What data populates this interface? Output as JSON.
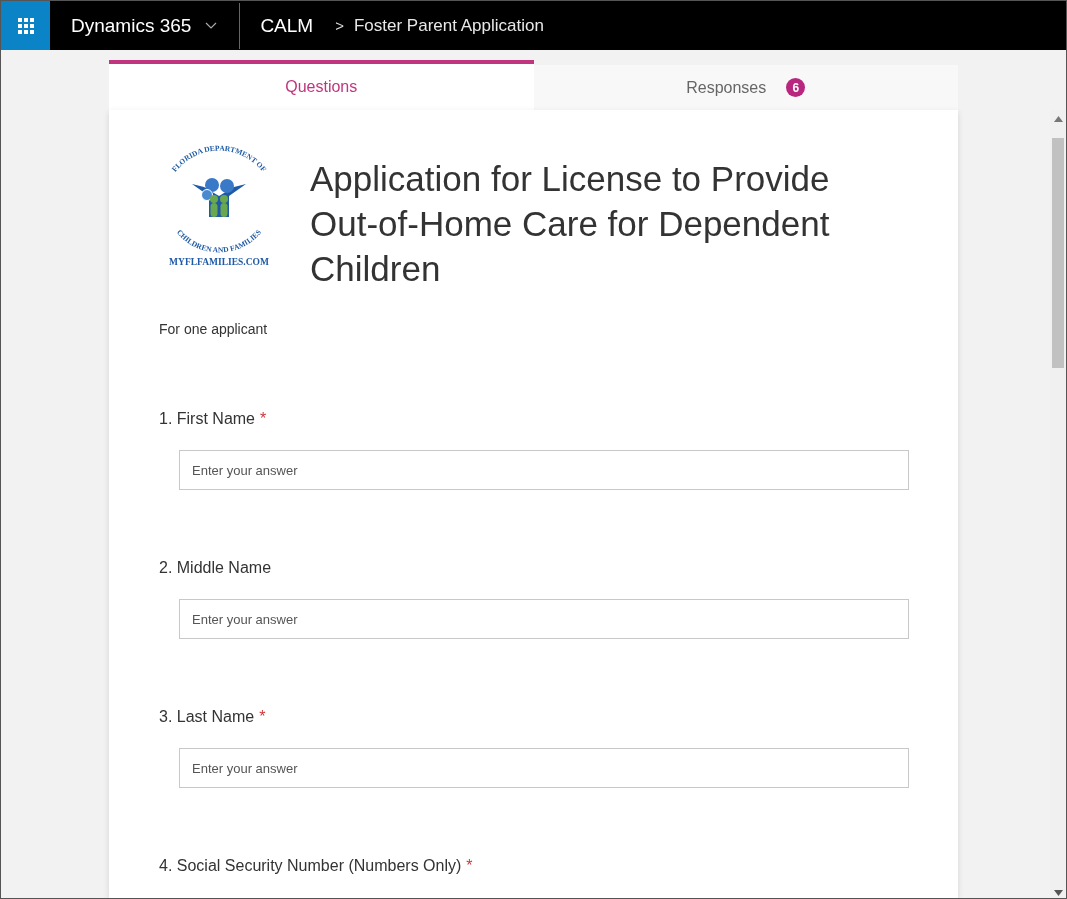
{
  "header": {
    "app_name": "Dynamics 365",
    "section": "CALM",
    "separator": ">",
    "page": "Foster Parent Application"
  },
  "tabs": [
    {
      "label": "Questions",
      "selected": true
    },
    {
      "label": "Responses",
      "selected": false,
      "badge": "6"
    }
  ],
  "form": {
    "logo": {
      "ring_top": "FLORIDA DEPARTMENT OF",
      "ring_bottom": "CHILDREN AND FAMILIES",
      "url": "MYFLFAMILIES.COM"
    },
    "title": "Application for License to Provide Out-of-Home Care for Dependent Children",
    "description": "For one applicant",
    "required_marker": "*",
    "questions": [
      {
        "label": "1. First Name",
        "required": true,
        "placeholder": "Enter your answer"
      },
      {
        "label": "2. Middle Name",
        "required": false,
        "placeholder": "Enter your answer"
      },
      {
        "label": "3. Last Name",
        "required": true,
        "placeholder": "Enter your answer"
      },
      {
        "label": "4. Social Security Number (Numbers Only)",
        "required": true
      }
    ]
  }
}
